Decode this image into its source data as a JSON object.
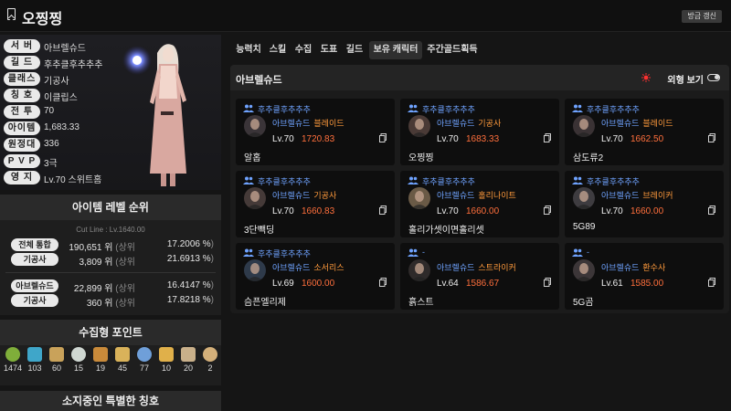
{
  "header": {
    "title": "오찡찡",
    "refresh_label": "방금 갱신"
  },
  "profile": {
    "rows": [
      {
        "label": "서 버",
        "value": "아브렐슈드"
      },
      {
        "label": "길 드",
        "value": "후추클후추추추"
      },
      {
        "label": "클래스",
        "value": "기공사"
      },
      {
        "label": "칭 호",
        "value": "이클립스"
      },
      {
        "label": "전 투",
        "value": "70"
      },
      {
        "label": "아이템",
        "value": "1,683.33"
      },
      {
        "label": "원정대",
        "value": "336"
      },
      {
        "label": "P V P",
        "value": "3극"
      },
      {
        "label": "영 지",
        "value": "Lv.70 스위트홈"
      }
    ]
  },
  "rank": {
    "title": "아이템 레벨 순위",
    "cutline": "Cut Line : Lv.1640.00",
    "rows": [
      {
        "name": "전체 통합",
        "pos": "190,651 위",
        "pct": "17.2006 %"
      },
      {
        "name": "기공사",
        "pos": "3,809 위",
        "pct": "21.6913 %"
      },
      {
        "name": "아브렐슈드",
        "pos": "22,899 위",
        "pct": "16.4147 %"
      },
      {
        "name": "기공사",
        "pos": "360 위",
        "pct": "17.8218 %"
      }
    ],
    "upper_label": "(상위",
    "close_paren": ")"
  },
  "collect": {
    "title": "수집형 포인트",
    "items": [
      {
        "icon": "seed-icon",
        "value": "1474",
        "color": "#7fae3a"
      },
      {
        "icon": "island-icon",
        "value": "103",
        "color": "#3fa6c9"
      },
      {
        "icon": "card-icon",
        "value": "60",
        "color": "#c9a25a"
      },
      {
        "icon": "mokoko-icon",
        "value": "15",
        "color": "#cfd7d2"
      },
      {
        "icon": "wing-icon",
        "value": "19",
        "color": "#c98a3a"
      },
      {
        "icon": "sword-icon",
        "value": "45",
        "color": "#d9b25a"
      },
      {
        "icon": "star-icon",
        "value": "77",
        "color": "#6f9fd9"
      },
      {
        "icon": "sun-icon",
        "value": "10",
        "color": "#e0b04a"
      },
      {
        "icon": "shell-icon",
        "value": "20",
        "color": "#c9b08a"
      },
      {
        "icon": "map-icon",
        "value": "2",
        "color": "#d4b07a"
      }
    ]
  },
  "special_titles": {
    "title": "소지중인 특별한 칭호"
  },
  "tabs": [
    "능력치",
    "스킬",
    "수집",
    "도표",
    "길드",
    "보유 캐릭터",
    "주간골드획득"
  ],
  "active_tab": 5,
  "characters": {
    "server": "아브렐슈드",
    "view_label": "외형 보기",
    "cards": [
      {
        "guild": "후추클후추추추",
        "server": "아브렐슈드",
        "class": "블레이드",
        "level": "Lv.70",
        "item_level": "1720.83",
        "name": "알홉",
        "portrait": "#3a3438"
      },
      {
        "guild": "후추클후추추추",
        "server": "아브렐슈드",
        "class": "기공사",
        "level": "Lv.70",
        "item_level": "1683.33",
        "name": "오찡찡",
        "portrait": "#4a3a36"
      },
      {
        "guild": "후추클후추추추",
        "server": "아브렐슈드",
        "class": "블레이드",
        "level": "Lv.70",
        "item_level": "1662.50",
        "name": "삼도류2",
        "portrait": "#3a3234"
      },
      {
        "guild": "후추클후추추추",
        "server": "아브렐슈드",
        "class": "기공사",
        "level": "Lv.70",
        "item_level": "1660.83",
        "name": "3단빽딩",
        "portrait": "#453a38"
      },
      {
        "guild": "후추클후추추추",
        "server": "아브렐슈드",
        "class": "홀리나이트",
        "level": "Lv.70",
        "item_level": "1660.00",
        "name": "홀리가셋이면홀리셋",
        "portrait": "#6a5a46"
      },
      {
        "guild": "후추클후추추추",
        "server": "아브렐슈드",
        "class": "브레이커",
        "level": "Lv.70",
        "item_level": "1660.00",
        "name": "5G89",
        "portrait": "#3e3c40"
      },
      {
        "guild": "후추클후추추추",
        "server": "아브렐슈드",
        "class": "소서리스",
        "level": "Lv.69",
        "item_level": "1600.00",
        "name": "슴픈엘리제",
        "portrait": "#2e3a4a"
      },
      {
        "guild": "-",
        "server": "아브렐슈드",
        "class": "스트라이커",
        "level": "Lv.64",
        "item_level": "1586.67",
        "name": "흙스트",
        "portrait": "#2e2a2a"
      },
      {
        "guild": "-",
        "server": "아브렐슈드",
        "class": "환수사",
        "level": "Lv.61",
        "item_level": "1585.00",
        "name": "5G곰",
        "portrait": "#3c3638"
      }
    ]
  },
  "colors": {
    "accent_blue": "#6fa3ff",
    "accent_orange": "#ff9a3c",
    "item_level": "#ff6f3c",
    "sun_red": "#ff3030"
  }
}
